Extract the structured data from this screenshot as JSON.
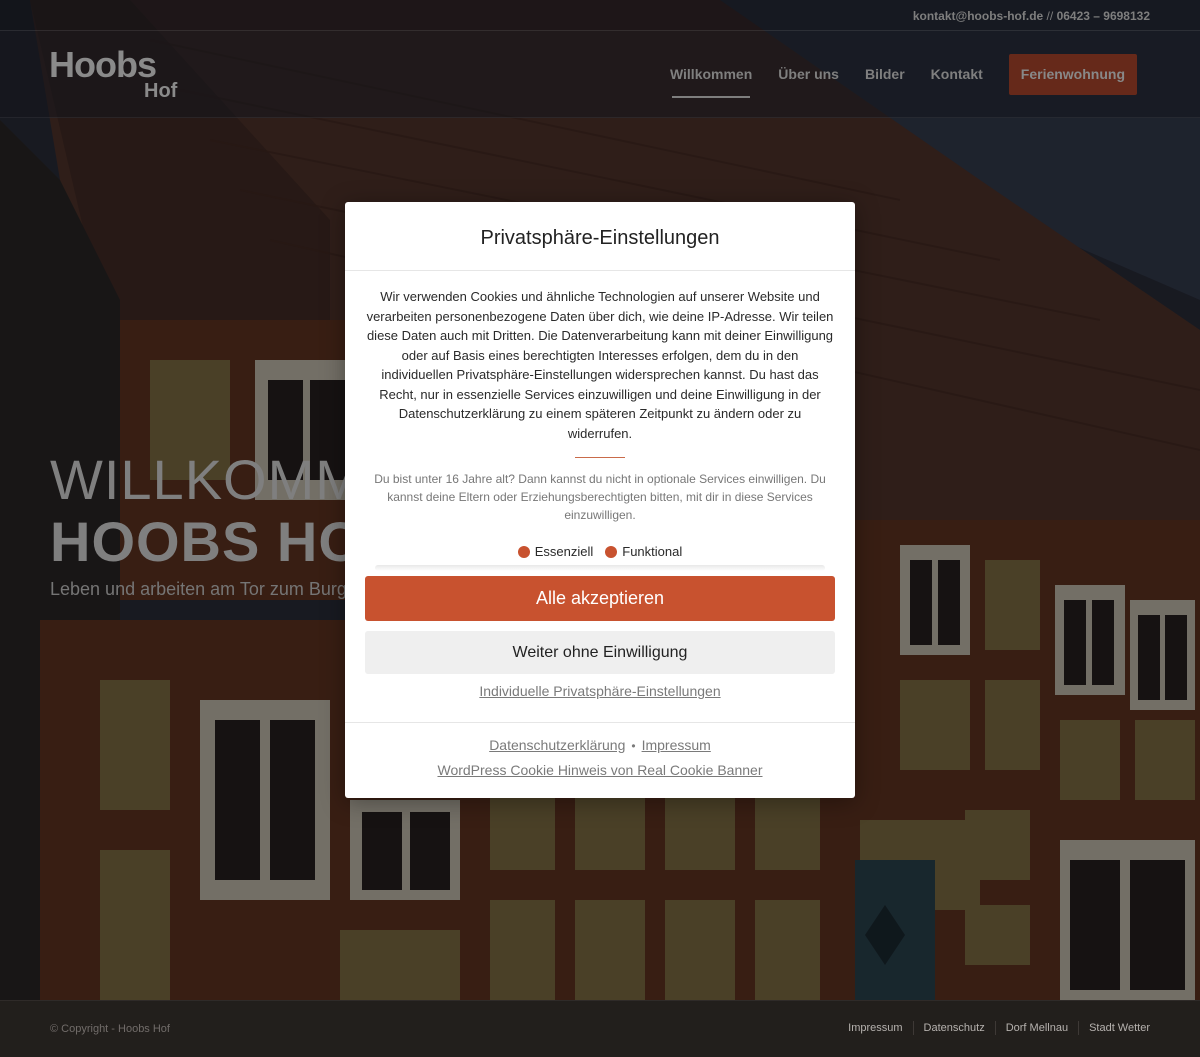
{
  "topbar": {
    "email": "kontakt@hoobs-hof.de",
    "separator": "//",
    "phone": "06423 – 9698132"
  },
  "logo": {
    "line1": "Hoobs",
    "line2": "Hof"
  },
  "nav": {
    "items": [
      {
        "label": "Willkommen"
      },
      {
        "label": "Über uns"
      },
      {
        "label": "Bilder"
      },
      {
        "label": "Kontakt"
      }
    ],
    "cta": "Ferienwohnung"
  },
  "hero": {
    "line1": "WILLKOMMEN",
    "line2": "HOOBS HOF",
    "subtitle": "Leben und arbeiten am Tor zum Burgwald"
  },
  "dialog": {
    "title": "Privatsphäre-Einstellungen",
    "intro": "Wir verwenden Cookies und ähnliche Technologien auf unserer Website und verarbeiten personenbezogene Daten über dich, wie deine IP-Adresse. Wir teilen diese Daten auch mit Dritten. Die Datenverarbeitung kann mit deiner Einwilligung oder auf Basis eines berechtigten Interesses erfolgen, dem du in den individuellen Privatsphäre-Einstellungen widersprechen kannst. Du hast das Recht, nur in essenzielle Services einzuwilligen und deine Einwilligung in der Datenschutzerklärung zu einem späteren Zeitpunkt zu ändern oder zu widerrufen.",
    "age_notice": "Du bist unter 16 Jahre alt? Dann kannst du nicht in optionale Services einwilligen. Du kannst deine Eltern oder Erziehungsberechtigten bitten, mit dir in diese Services einzuwilligen.",
    "groups": [
      "Essenziell",
      "Funktional"
    ],
    "accept_label": "Alle akzeptieren",
    "reject_label": "Weiter ohne Einwilligung",
    "individual_label": "Individuelle Privatsphäre-Einstellungen",
    "footer": {
      "privacy": "Datenschutzerklärung",
      "bullet": "•",
      "imprint": "Impressum",
      "powered_by": "WordPress Cookie Hinweis von Real Cookie Banner"
    },
    "accent_color": "#c8522f"
  },
  "footer": {
    "copyright": "© Copyright - Hoobs Hof",
    "links": [
      "Impressum",
      "Datenschutz",
      "Dorf Mellnau",
      "Stadt Wetter"
    ]
  }
}
